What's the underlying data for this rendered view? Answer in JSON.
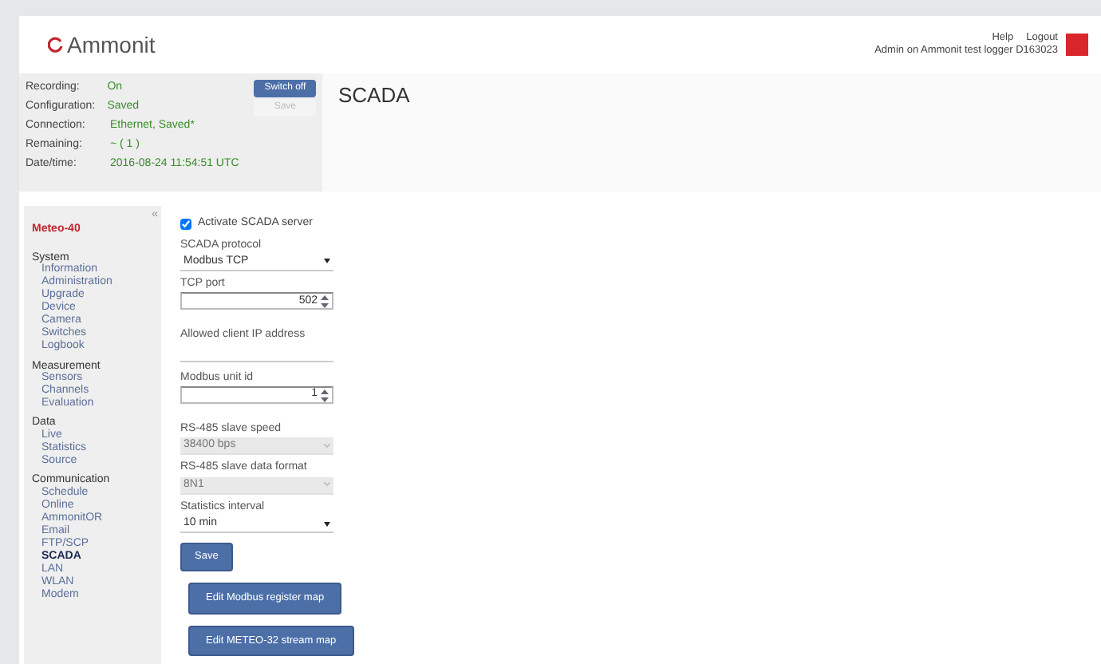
{
  "header": {
    "logo": "Ammonit",
    "links": [
      "Help",
      "Logout"
    ],
    "user": "Admin on Ammonit test logger D163023"
  },
  "status": {
    "rows": [
      {
        "label": "Recording:",
        "value": "On"
      },
      {
        "label": "Configuration:",
        "value": "Saved"
      },
      {
        "label": "Connection:",
        "value": "Ethernet, Saved*"
      },
      {
        "label": "Remaining:",
        "value": "~ ( 1 )"
      },
      {
        "label": "Date/time:",
        "value": "2016-08-24 11:54:51 UTC"
      }
    ],
    "buttons": [
      {
        "label": "Switch off",
        "disabled": false
      },
      {
        "label": "Save",
        "disabled": true
      }
    ]
  },
  "page_title": "SCADA",
  "sidebar": {
    "title": "Meteo-40",
    "collapse": "«",
    "groups": [
      {
        "label": "System",
        "items": [
          {
            "label": "Information",
            "selected": false
          },
          {
            "label": "Administration",
            "selected": false
          },
          {
            "label": "Upgrade",
            "selected": false
          },
          {
            "label": "Device",
            "selected": false
          },
          {
            "label": "Camera",
            "selected": false
          },
          {
            "label": "Switches",
            "selected": false
          },
          {
            "label": "Logbook",
            "selected": false
          }
        ]
      },
      {
        "label": "Measurement",
        "items": [
          {
            "label": "Sensors",
            "selected": false
          },
          {
            "label": "Channels",
            "selected": false
          },
          {
            "label": "Evaluation",
            "selected": false
          }
        ]
      },
      {
        "label": "Data",
        "items": [
          {
            "label": "Live",
            "selected": false
          },
          {
            "label": "Statistics",
            "selected": false
          },
          {
            "label": "Source",
            "selected": false
          }
        ]
      },
      {
        "label": "Communication",
        "items": [
          {
            "label": "Schedule",
            "selected": false
          },
          {
            "label": "Online",
            "selected": false
          },
          {
            "label": "AmmonitOR",
            "selected": false
          },
          {
            "label": "Email",
            "selected": false
          },
          {
            "label": "FTP/SCP",
            "selected": false
          },
          {
            "label": "SCADA",
            "selected": true
          },
          {
            "label": "LAN",
            "selected": false
          },
          {
            "label": "WLAN",
            "selected": false
          },
          {
            "label": "Modem",
            "selected": false
          }
        ]
      }
    ]
  },
  "form": {
    "activate": {
      "label": "Activate SCADA server",
      "checked": true
    },
    "fields": [
      {
        "kind": "select",
        "label": "SCADA protocol",
        "value": "Modbus TCP",
        "disabled": false
      },
      {
        "kind": "number",
        "label": "TCP port",
        "value": "502",
        "disabled": false
      },
      {
        "kind": "text",
        "label": "Allowed client IP address",
        "disabled": false
      },
      {
        "kind": "number",
        "label": "Modbus unit id",
        "value": "1",
        "disabled": false
      },
      {
        "kind": "select",
        "label": "RS-485 slave speed",
        "value": "38400 bps",
        "disabled": true
      },
      {
        "kind": "select",
        "label": "RS-485 slave data format",
        "value": "8N1",
        "disabled": true
      },
      {
        "kind": "select",
        "label": "Statistics interval",
        "value": "10 min",
        "disabled": false
      }
    ],
    "save": "Save",
    "actions": [
      "Edit Modbus register map",
      "Edit METEO-32 stream map"
    ]
  }
}
